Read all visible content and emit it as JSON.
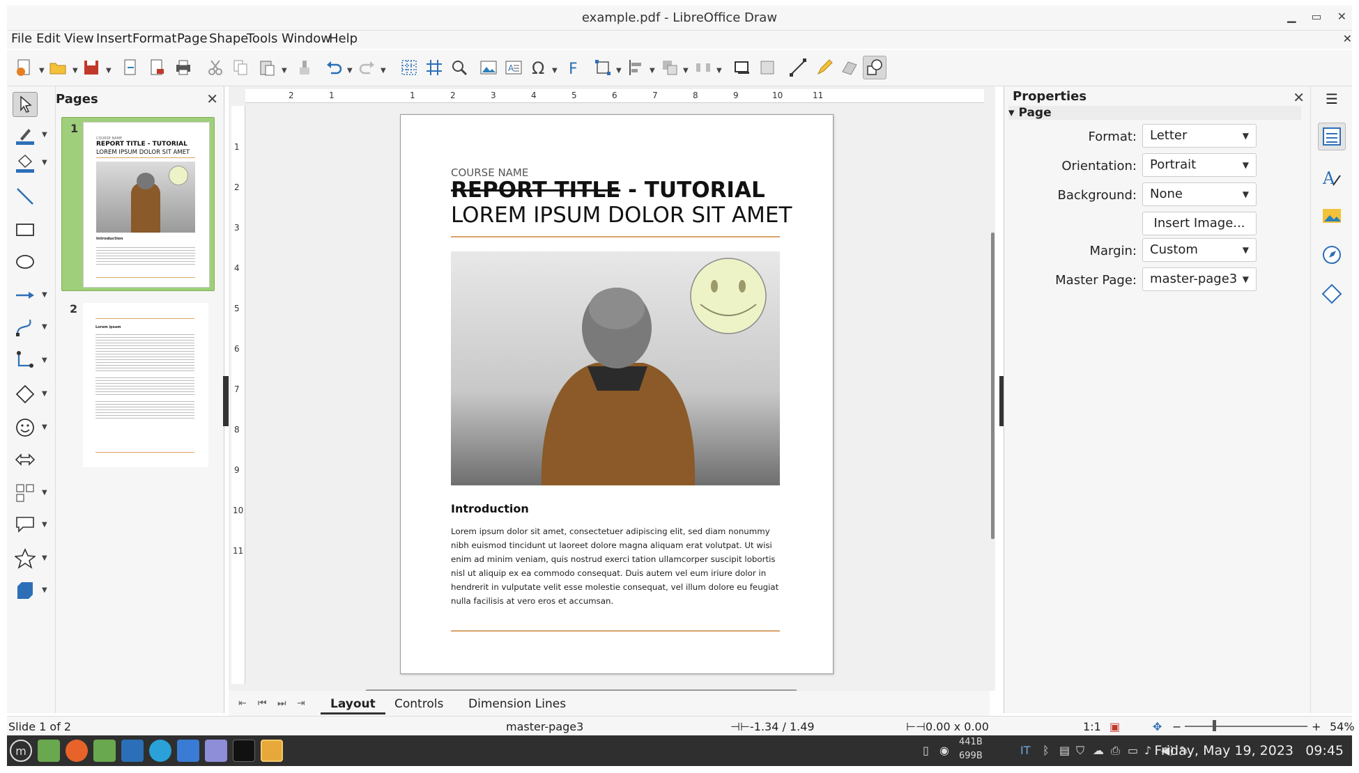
{
  "window": {
    "title": "example.pdf - LibreOffice Draw"
  },
  "menu": [
    "File",
    "Edit",
    "View",
    "Insert",
    "Format",
    "Page",
    "Shape",
    "Tools",
    "Window",
    "Help"
  ],
  "pages_panel": {
    "title": "Pages",
    "pages": [
      {
        "number": "1"
      },
      {
        "number": "2"
      }
    ]
  },
  "document": {
    "course_name": "COURSE NAME",
    "title_struck": "REPORT TITLE",
    "title_rest": " - TUTORIAL",
    "subtitle": "LOREM IPSUM DOLOR SIT AMET",
    "intro_heading": "Introduction",
    "body_text": "Lorem ipsum dolor sit amet, consectetuer adipiscing elit, sed diam nonummy nibh euismod tincidunt ut laoreet dolore magna aliquam erat volutpat. Ut wisi enim ad minim veniam, quis nostrud exerci tation ullamcorper suscipit lobortis nisl ut aliquip ex ea commodo consequat. Duis autem vel eum iriure dolor in hendrerit in vulputate velit esse molestie consequat, vel illum dolore eu feugiat nulla facilisis at vero eros et accumsan."
  },
  "thumb1": {
    "course": "COURSE NAME",
    "title": "REPORT TITLE - TUTORIAL",
    "subtitle": "LOREM IPSUM DOLOR SIT AMET",
    "intro": "Introduction"
  },
  "thumb2": {
    "heading": "Lorem ipsum"
  },
  "ruler": {
    "h_ticks": [
      "2",
      "1",
      "1",
      "2",
      "3",
      "4",
      "5",
      "6",
      "7",
      "8",
      "9",
      "10",
      "11"
    ],
    "v_ticks": [
      "1",
      "2",
      "3",
      "4",
      "5",
      "6",
      "7",
      "8",
      "9",
      "10",
      "11"
    ]
  },
  "tabs": [
    {
      "label": "Layout"
    },
    {
      "label": "Controls"
    },
    {
      "label": "Dimension Lines"
    }
  ],
  "properties": {
    "title": "Properties",
    "section": "Page",
    "format_label": "Format:",
    "format_value": "Letter",
    "orientation_label": "Orientation:",
    "orientation_value": "Portrait",
    "background_label": "Background:",
    "background_value": "None",
    "insert_image": "Insert Image...",
    "margin_label": "Margin:",
    "margin_value": "Custom",
    "master_label": "Master Page:",
    "master_value": "master-page3"
  },
  "status": {
    "slide": "Slide 1 of 2",
    "master": "master-page3",
    "position": "-1.34 / 1.49",
    "size": "0.00 x 0.00",
    "scale": "1:1",
    "zoom": "54%"
  },
  "taskbar": {
    "net_up": "441B",
    "net_down": "699B",
    "lang": "IT",
    "date": "Friday, May 19, 2023",
    "time": "09:45"
  },
  "colors": {
    "accent_rule": "#d9a36a",
    "selected_thumb": "#9fcf7a",
    "smiley_fill": "#eef3c7",
    "taskbar_bg": "#2f2f2f"
  },
  "icons": {
    "selector": "arrow-pointer-icon",
    "close": "close-icon"
  }
}
